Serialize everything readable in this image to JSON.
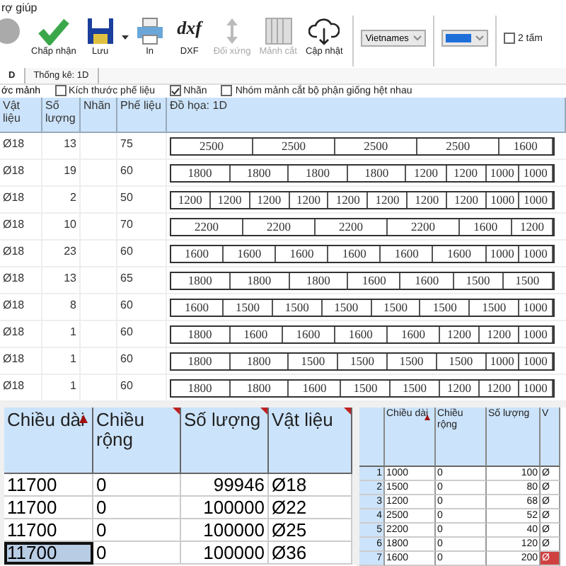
{
  "menu": {
    "label": "rợ giúp"
  },
  "toolbar": [
    {
      "kind": "circle",
      "disabled": true
    },
    {
      "kind": "check",
      "label": "Chấp nhận",
      "disabled": false
    },
    {
      "kind": "save",
      "label": "Lưu",
      "disabled": false
    },
    {
      "kind": "print",
      "label": "In",
      "disabled": false
    },
    {
      "kind": "dxf",
      "icon_text": "dxf",
      "label": "DXF",
      "disabled": false
    },
    {
      "kind": "mirror",
      "label": "Đối xứng",
      "disabled": true
    },
    {
      "kind": "grid",
      "label": "Mảnh cắt",
      "disabled": true
    },
    {
      "kind": "cloud",
      "label": "Cập nhật",
      "disabled": false
    }
  ],
  "language_select": {
    "value": "Vietnames"
  },
  "color_select": {
    "color": "#1e6fd9"
  },
  "two_sheets": {
    "label": "2 tấm",
    "checked": false
  },
  "tabs": [
    {
      "label": "D",
      "selected": true
    },
    {
      "label": "Thống kê: 1D",
      "selected": false
    }
  ],
  "options": [
    {
      "label": "ớc mảnh",
      "kind": "text"
    },
    {
      "label": "Kích thước phế liệu",
      "kind": "checkbox",
      "checked": false
    },
    {
      "label": "Nhãn",
      "kind": "checkbox",
      "checked": true
    },
    {
      "label": "Nhóm mảnh cắt bộ phận giống hệt nhau",
      "kind": "checkbox",
      "checked": false
    }
  ],
  "pattern_table": {
    "columns": [
      "Vật liệu",
      "Số lượng",
      "Nhãn",
      "Phế liệu",
      "Đồ họa: 1D"
    ],
    "rows": [
      {
        "material": "Ø18",
        "quantity": "13",
        "label": "",
        "waste": "75",
        "pieces": [
          "2500",
          "2500",
          "2500",
          "2500",
          "1600"
        ]
      },
      {
        "material": "Ø18",
        "quantity": "19",
        "label": "",
        "waste": "60",
        "pieces": [
          "1800",
          "1800",
          "1800",
          "1800",
          "1200",
          "1200",
          "1000",
          "1000"
        ]
      },
      {
        "material": "Ø18",
        "quantity": "2",
        "label": "",
        "waste": "50",
        "pieces": [
          "1200",
          "1200",
          "1200",
          "1200",
          "1200",
          "1200",
          "1200",
          "1200",
          "1000",
          "1000"
        ]
      },
      {
        "material": "Ø18",
        "quantity": "10",
        "label": "",
        "waste": "70",
        "pieces": [
          "2200",
          "2200",
          "2200",
          "2200",
          "1600",
          "1200"
        ]
      },
      {
        "material": "Ø18",
        "quantity": "23",
        "label": "",
        "waste": "60",
        "pieces": [
          "1600",
          "1600",
          "1600",
          "1600",
          "1600",
          "1600",
          "1000",
          "1000"
        ]
      },
      {
        "material": "Ø18",
        "quantity": "13",
        "label": "",
        "waste": "65",
        "pieces": [
          "1800",
          "1800",
          "1800",
          "1600",
          "1600",
          "1500",
          "1500"
        ]
      },
      {
        "material": "Ø18",
        "quantity": "8",
        "label": "",
        "waste": "60",
        "pieces": [
          "1600",
          "1500",
          "1500",
          "1500",
          "1500",
          "1500",
          "1500",
          "1000"
        ]
      },
      {
        "material": "Ø18",
        "quantity": "1",
        "label": "",
        "waste": "60",
        "pieces": [
          "1800",
          "1600",
          "1600",
          "1600",
          "1600",
          "1200",
          "1200",
          "1000"
        ]
      },
      {
        "material": "Ø18",
        "quantity": "1",
        "label": "",
        "waste": "60",
        "pieces": [
          "1800",
          "1800",
          "1500",
          "1500",
          "1500",
          "1500",
          "1000",
          "1000"
        ]
      },
      {
        "material": "Ø18",
        "quantity": "1",
        "label": "",
        "waste": "60",
        "pieces": [
          "1800",
          "1800",
          "1600",
          "1500",
          "1500",
          "1200",
          "1200",
          "1000"
        ]
      }
    ]
  },
  "stock_table": {
    "columns": [
      "Chiều dài",
      "Chiều rộng",
      "Số lượng",
      "Vật liệu"
    ],
    "rows": [
      {
        "cells": [
          "11700",
          "0",
          "99946",
          "Ø18"
        ],
        "selected": false
      },
      {
        "cells": [
          "11700",
          "0",
          "100000",
          "Ø22"
        ],
        "selected": false
      },
      {
        "cells": [
          "11700",
          "0",
          "100000",
          "Ø25"
        ],
        "selected": false
      },
      {
        "cells": [
          "11700",
          "0",
          "100000",
          "Ø36"
        ],
        "selected": true
      }
    ]
  },
  "parts_table": {
    "columns": [
      "Chiều dài",
      "Chiều rộng",
      "Số lượng",
      "V"
    ],
    "rows": [
      {
        "number": "1",
        "cells": [
          "1000",
          "0",
          "100",
          "Ø"
        ],
        "flagged": false
      },
      {
        "number": "2",
        "cells": [
          "1500",
          "0",
          "80",
          "Ø"
        ],
        "flagged": false
      },
      {
        "number": "3",
        "cells": [
          "1200",
          "0",
          "68",
          "Ø"
        ],
        "flagged": false
      },
      {
        "number": "4",
        "cells": [
          "2500",
          "0",
          "52",
          "Ø"
        ],
        "flagged": false
      },
      {
        "number": "5",
        "cells": [
          "2200",
          "0",
          "40",
          "Ø"
        ],
        "flagged": false
      },
      {
        "number": "6",
        "cells": [
          "1800",
          "0",
          "120",
          "Ø"
        ],
        "flagged": false
      },
      {
        "number": "7",
        "cells": [
          "1600",
          "0",
          "200",
          "Ø"
        ],
        "flagged": true
      }
    ]
  }
}
